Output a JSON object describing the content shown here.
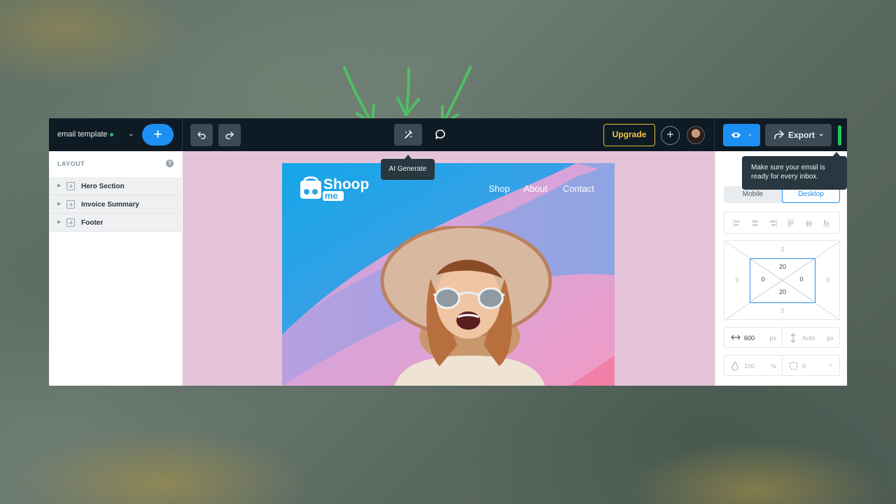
{
  "app": {
    "doc_title": "email template",
    "status_color": "#23c26b",
    "accent_color": "#1d8ef2"
  },
  "toolbar": {
    "add_icon": "plus-icon",
    "undo_icon": "undo-icon",
    "redo_icon": "redo-icon",
    "ai_icon": "magic-wand-icon",
    "comment_icon": "comment-icon",
    "upgrade_label": "Upgrade",
    "preview_icon": "eye-icon",
    "export_label": "Export"
  },
  "tooltips": {
    "ai_generate": "AI Generate",
    "email_ready_line1": "Make sure your email is",
    "email_ready_line2": "ready for every inbox."
  },
  "layers": {
    "title": "LAYOUT",
    "help": "?",
    "items": [
      {
        "label": "Hero Section"
      },
      {
        "label": "Invoice Summary"
      },
      {
        "label": "Footer"
      }
    ]
  },
  "email": {
    "logo_top": "Shoop",
    "logo_bottom": "me",
    "nav": [
      "Shop",
      "About",
      "Contact"
    ]
  },
  "properties": {
    "device_tabs": {
      "mobile": "Mobile",
      "desktop": "Desktop",
      "selected": "Desktop"
    },
    "margin": {
      "top": "0",
      "right": "0",
      "bottom": "0",
      "left": "0"
    },
    "padding": {
      "top": "20",
      "right": "0",
      "bottom": "20",
      "left": "0"
    },
    "width": {
      "value": "600",
      "unit": "px"
    },
    "height": {
      "value": "Auto",
      "unit": "px"
    },
    "opacity": {
      "value": "100",
      "unit": "%"
    },
    "radius": {
      "value": "0"
    }
  }
}
